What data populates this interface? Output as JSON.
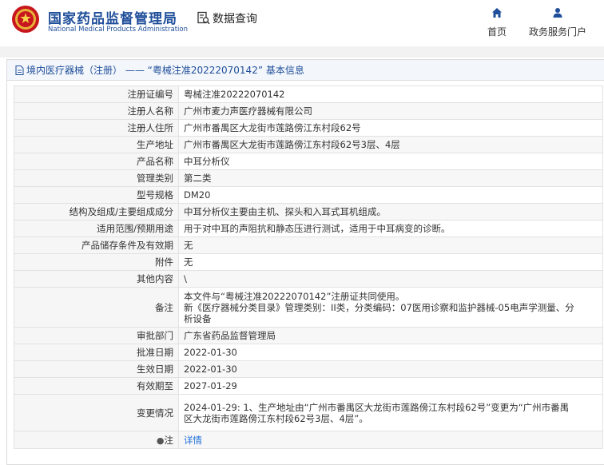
{
  "header": {
    "brand_cn": "国家药品监督管理局",
    "brand_en": "National Medical Products Administration",
    "query_label": "数据查询",
    "nav": [
      {
        "label": "首页",
        "icon": "home-icon"
      },
      {
        "label": "政务服务门户",
        "icon": "user-icon"
      }
    ]
  },
  "panel": {
    "title": "境内医疗器械（注册） —— “粤械注准20222070142” 基本信息"
  },
  "rows": [
    {
      "key": "注册证编号",
      "value": "粤械注准20222070142"
    },
    {
      "key": "注册人名称",
      "value": "广州市麦力声医疗器械有限公司"
    },
    {
      "key": "注册人住所",
      "value": "广州市番禺区大龙街市莲路傍江东村段62号"
    },
    {
      "key": "生产地址",
      "value": "广州市番禺区大龙街市莲路傍江东村段62号3层、4层"
    },
    {
      "key": "产品名称",
      "value": "中耳分析仪"
    },
    {
      "key": "管理类别",
      "value": "第二类"
    },
    {
      "key": "型号规格",
      "value": "DM20"
    },
    {
      "key": "结构及组成/主要组成成分",
      "value": "中耳分析仪主要由主机、探头和入耳式耳机组成。"
    },
    {
      "key": "适用范围/预期用途",
      "value": "用于对中耳的声阻抗和静态压进行测试，适用于中耳病变的诊断。"
    },
    {
      "key": "产品储存条件及有效期",
      "value": "无"
    },
    {
      "key": "附件",
      "value": "无"
    },
    {
      "key": "其他内容",
      "value": "\\"
    },
    {
      "key": "备注",
      "value_lines": [
        "本文件与“粤械注准20222070142”注册证共同使用。",
        "新《医疗器械分类目录》管理类别：II类，分类编码：07医用诊察和监护器械-05电声学测量、分",
        "析设备"
      ]
    },
    {
      "key": "审批部门",
      "value": "广东省药品监督管理局"
    },
    {
      "key": "批准日期",
      "value": "2022-01-30"
    },
    {
      "key": "生效日期",
      "value": "2022-01-30"
    },
    {
      "key": "有效期至",
      "value": "2027-01-29"
    },
    {
      "key": "变更情况",
      "value_lines": [
        "2024-01-29: 1、生产地址由“广州市番禺区大龙街市莲路傍江东村段62号”变更为“广州市番禺",
        "区大龙街市莲路傍江东村段62号3层、4层”。"
      ]
    },
    {
      "key": "注",
      "value": "详情"
    }
  ],
  "colors": {
    "brand_blue": "#1f4e9a",
    "link_blue": "#1e6fd9",
    "label_bg": "#f6f6f6",
    "alt_row_bg": "#f7f7f7"
  }
}
